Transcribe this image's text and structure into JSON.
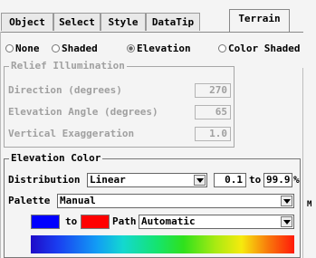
{
  "tabs": [
    {
      "label": "Object"
    },
    {
      "label": "Select"
    },
    {
      "label": "Style"
    },
    {
      "label": "DataTip"
    },
    {
      "label": "Terrain"
    }
  ],
  "active_tab": "Terrain",
  "shading_options": [
    {
      "label": "None",
      "selected": false
    },
    {
      "label": "Shaded",
      "selected": false
    },
    {
      "label": "Elevation",
      "selected": true
    },
    {
      "label": "Color Shaded",
      "selected": false
    }
  ],
  "relief": {
    "legend": "Relief Illumination",
    "direction_label": "Direction (degrees)",
    "direction_value": "270",
    "elevation_label": "Elevation Angle (degrees)",
    "elevation_value": "65",
    "exaggeration_label": "Vertical Exaggeration",
    "exaggeration_value": "1.0"
  },
  "elevation_color": {
    "legend": "Elevation Color",
    "distribution_label": "Distribution",
    "distribution_value": "Linear",
    "range_min": "0.1",
    "range_to": "to",
    "range_max": "99.9",
    "range_unit": "%",
    "palette_label": "Palette",
    "palette_value": "Manual",
    "to_label": "to",
    "path_label": "Path",
    "path_value": "Automatic",
    "start_color": "#0000ff",
    "end_color": "#ff0000"
  },
  "side_fragment": "M"
}
